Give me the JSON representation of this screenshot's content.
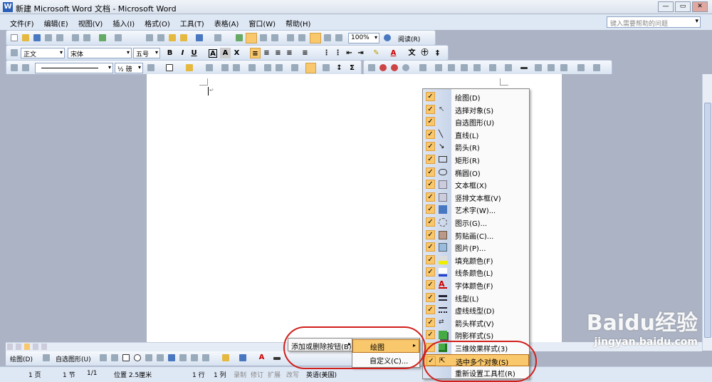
{
  "window": {
    "title": "新建 Microsoft Word 文档 - Microsoft Word"
  },
  "menubar": {
    "items": [
      "文件(F)",
      "编辑(E)",
      "视图(V)",
      "插入(I)",
      "格式(O)",
      "工具(T)",
      "表格(A)",
      "窗口(W)",
      "帮助(H)"
    ],
    "help_placeholder": "键入需要帮助的问题"
  },
  "standard_toolbar": {
    "zoom": "100%",
    "read_button": "阅读(R)"
  },
  "format_toolbar": {
    "style": "正文",
    "font": "宋体",
    "size": "五号"
  },
  "tables_toolbar": {
    "line_weight": "½ 磅"
  },
  "context_menu": {
    "add_remove": "添加或删除按钮(B)",
    "submenu": [
      "绘图",
      "自定义(C)..."
    ]
  },
  "drawing_menu": {
    "items": [
      {
        "label": "绘图(D)",
        "icon": "drawing-icon",
        "checked": true
      },
      {
        "label": "选择对象(S)",
        "icon": "select-objects-icon",
        "checked": true
      },
      {
        "label": "自选图形(U)",
        "icon": "autoshapes-icon",
        "checked": true
      },
      {
        "label": "直线(L)",
        "icon": "line-icon",
        "checked": true
      },
      {
        "label": "箭头(R)",
        "icon": "arrow-icon",
        "checked": true
      },
      {
        "label": "矩形(R)",
        "icon": "rectangle-icon",
        "checked": true
      },
      {
        "label": "椭圆(O)",
        "icon": "oval-icon",
        "checked": true
      },
      {
        "label": "文本框(X)",
        "icon": "textbox-icon",
        "checked": true
      },
      {
        "label": "竖排文本框(V)",
        "icon": "vertical-textbox-icon",
        "checked": true
      },
      {
        "label": "艺术字(W)...",
        "icon": "wordart-icon",
        "checked": true
      },
      {
        "label": "图示(G)...",
        "icon": "diagram-icon",
        "checked": true
      },
      {
        "label": "剪贴画(C)...",
        "icon": "clipart-icon",
        "checked": true
      },
      {
        "label": "图片(P)...",
        "icon": "picture-icon",
        "checked": true
      },
      {
        "label": "填充颜色(F)",
        "icon": "fill-color-icon",
        "checked": true
      },
      {
        "label": "线条颜色(L)",
        "icon": "line-color-icon",
        "checked": true
      },
      {
        "label": "字体颜色(F)",
        "icon": "font-color-icon",
        "checked": true
      },
      {
        "label": "线型(L)",
        "icon": "line-style-icon",
        "checked": true
      },
      {
        "label": "虚线线型(D)",
        "icon": "dash-style-icon",
        "checked": true
      },
      {
        "label": "箭头样式(V)",
        "icon": "arrow-style-icon",
        "checked": true
      },
      {
        "label": "阴影样式(S)",
        "icon": "shadow-style-icon",
        "checked": true
      },
      {
        "label": "三维效果样式(3)",
        "icon": "3d-style-icon",
        "checked": true
      },
      {
        "label": "选中多个对象(S)",
        "icon": "select-multiple-icon",
        "checked": true,
        "highlighted": true
      },
      {
        "label": "重新设置工具栏(R)",
        "icon": "",
        "checked": false
      }
    ]
  },
  "drawing_toolbar": {
    "draw": "绘图(D)",
    "autoshapes": "自选图形(U)"
  },
  "status": {
    "page": "1 页",
    "section": "1 节",
    "pages": "1/1",
    "position": "位置 2.5厘米",
    "line": "1 行",
    "col": "1 列",
    "rec": "录制",
    "trk": "修订",
    "ext": "扩展",
    "ovr": "改写",
    "lang": "英语(美国)"
  },
  "watermark": {
    "text": "Baidu经验",
    "url": "jingyan.baidu.com"
  },
  "colors": {
    "highlight": "#f9c76c",
    "annotation": "#d0201c"
  }
}
